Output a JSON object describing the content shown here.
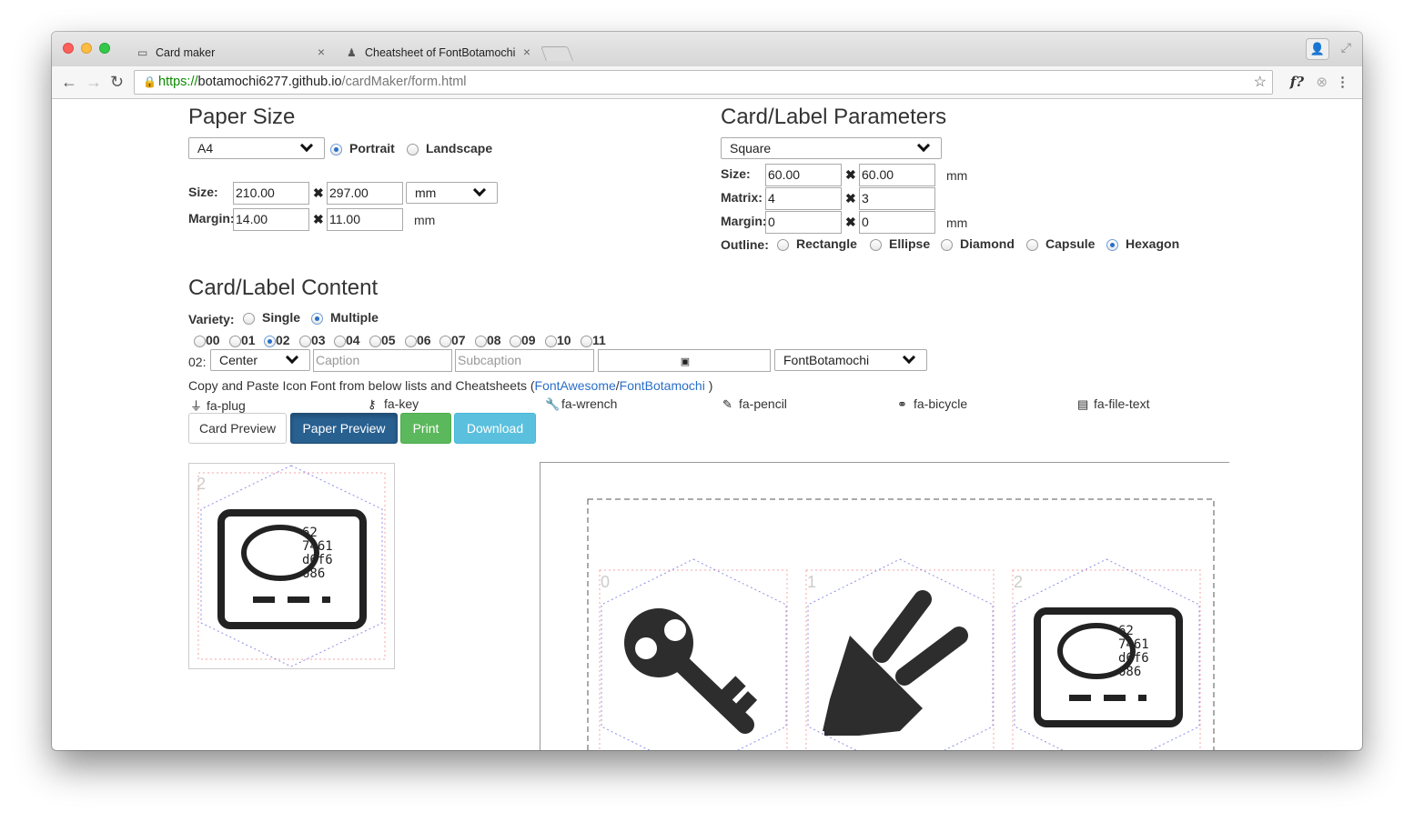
{
  "browser": {
    "tabs": [
      {
        "title": "Card maker",
        "icon": "card-icon"
      },
      {
        "title": "Cheatsheet of FontBotamochi",
        "icon": "robot-icon"
      }
    ],
    "url": {
      "scheme": "https://",
      "host": "botamochi6277.github.io",
      "path": "/cardMaker/form.html"
    },
    "extension_label": "f?"
  },
  "paper": {
    "title": "Paper Size",
    "size_select": "A4",
    "orientation": {
      "options": [
        "Portrait",
        "Landscape"
      ],
      "selected": "Portrait"
    },
    "size_label": "Size:",
    "width": "210.00",
    "height": "297.00",
    "unit_select": "mm",
    "margin_label": "Margin:",
    "margin_x": "14.00",
    "margin_y": "11.00",
    "margin_unit": "mm"
  },
  "card_params": {
    "title": "Card/Label Parameters",
    "shape_select": "Square",
    "size_label": "Size:",
    "width": "60.00",
    "height": "60.00",
    "size_unit": "mm",
    "matrix_label": "Matrix:",
    "matrix_cols": "4",
    "matrix_rows": "3",
    "margin_label": "Margin:",
    "margin_x": "0",
    "margin_y": "0",
    "margin_unit": "mm",
    "outline_label": "Outline:",
    "outline_options": [
      "Rectangle",
      "Ellipse",
      "Diamond",
      "Capsule",
      "Hexagon"
    ],
    "outline_selected": "Hexagon"
  },
  "content": {
    "title": "Card/Label Content",
    "variety_label": "Variety:",
    "variety_options": [
      "Single",
      "Multiple"
    ],
    "variety_selected": "Multiple",
    "indices": [
      "00",
      "01",
      "02",
      "03",
      "04",
      "05",
      "06",
      "07",
      "08",
      "09",
      "10",
      "11"
    ],
    "selected_index": "02",
    "row_label": "02:",
    "align_select": "Center",
    "caption_placeholder": "Caption",
    "subcaption_placeholder": "Subcaption",
    "icon_input_value": "",
    "font_select": "FontBotamochi",
    "help_text_prefix": "Copy and Paste Icon Font from below lists and Cheatsheets (",
    "help_link1": "FontAwesome",
    "help_sep": "/",
    "help_link2": "FontBotamochi",
    "help_text_suffix": " )",
    "icon_list": [
      {
        "glyph": "plug-icon",
        "name": "fa-plug"
      },
      {
        "glyph": "key-icon",
        "name": "fa-key"
      },
      {
        "glyph": "wrench-icon",
        "name": "fa-wrench"
      },
      {
        "glyph": "pencil-icon",
        "name": "fa-pencil"
      },
      {
        "glyph": "bicycle-icon",
        "name": "fa-bicycle"
      },
      {
        "glyph": "file-text-icon",
        "name": "fa-file-text"
      }
    ]
  },
  "buttons": {
    "card_preview": "Card Preview",
    "paper_preview": "Paper Preview",
    "print": "Print",
    "download": "Download"
  },
  "preview": {
    "single_card_number": "2",
    "single_card_code": [
      "62",
      "7461",
      "d6f6",
      "686"
    ],
    "paper_cards": [
      {
        "number": "0",
        "icon": "key-icon"
      },
      {
        "number": "1",
        "icon": "plug-icon"
      },
      {
        "number": "2",
        "icon": "robot-face-icon"
      }
    ]
  },
  "colors": {
    "primary": "#286090",
    "success": "#5cb85c",
    "info": "#5bc0de",
    "link": "#2a6fc9",
    "secure_green": "#0b8a00"
  }
}
